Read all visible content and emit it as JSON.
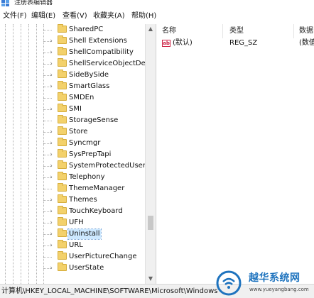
{
  "window": {
    "title": "注册表编辑器"
  },
  "menu": [
    "文件(F)",
    "编辑(E)",
    "查看(V)",
    "收藏夹(A)",
    "帮助(H)"
  ],
  "tree": {
    "items": [
      {
        "label": "SharedPC",
        "expandable": false
      },
      {
        "label": "Shell Extensions",
        "expandable": true
      },
      {
        "label": "ShellCompatibility",
        "expandable": true
      },
      {
        "label": "ShellServiceObjectDela",
        "expandable": true
      },
      {
        "label": "SideBySide",
        "expandable": true
      },
      {
        "label": "SmartGlass",
        "expandable": true
      },
      {
        "label": "SMDEn",
        "expandable": false
      },
      {
        "label": "SMI",
        "expandable": true
      },
      {
        "label": "StorageSense",
        "expandable": false
      },
      {
        "label": "Store",
        "expandable": true
      },
      {
        "label": "Syncmgr",
        "expandable": true
      },
      {
        "label": "SysPrepTapi",
        "expandable": true
      },
      {
        "label": "SystemProtectedUserD",
        "expandable": true
      },
      {
        "label": "Telephony",
        "expandable": true
      },
      {
        "label": "ThemeManager",
        "expandable": false
      },
      {
        "label": "Themes",
        "expandable": true
      },
      {
        "label": "TouchKeyboard",
        "expandable": true
      },
      {
        "label": "UFH",
        "expandable": true
      },
      {
        "label": "Uninstall",
        "expandable": true,
        "selected": true
      },
      {
        "label": "URL",
        "expandable": true
      },
      {
        "label": "UserPictureChange",
        "expandable": false
      },
      {
        "label": "UserState",
        "expandable": true
      }
    ]
  },
  "list": {
    "columns": [
      "名称",
      "类型",
      "数据"
    ],
    "rows": [
      {
        "icon": "ab",
        "name": "(默认)",
        "type": "REG_SZ",
        "data": "(数值"
      }
    ]
  },
  "statusbar": {
    "path": "计算机\\HKEY_LOCAL_MACHINE\\SOFTWARE\\Microsoft\\Windows"
  },
  "watermark": {
    "brand": "越华系统网",
    "url": "www.yueyangbang.com"
  },
  "colors": {
    "folder": "#f3d16b",
    "selection": "#cde8ff",
    "watermark": "#1e73be"
  },
  "icons": {
    "window": "regedit-icon",
    "folder": "folder-icon",
    "expander": "chevron-right-icon",
    "value": "string-value-icon"
  }
}
